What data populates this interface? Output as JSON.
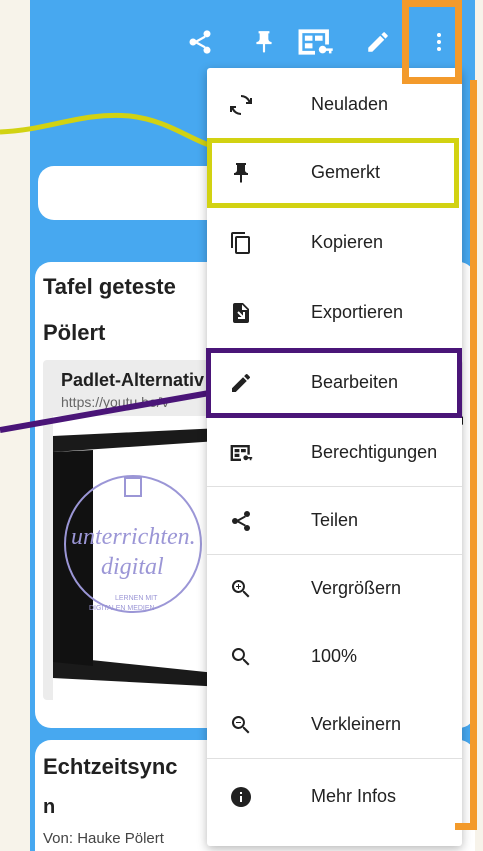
{
  "toolbar": {
    "icons": [
      "share-icon",
      "pin-icon",
      "permissions-icon",
      "edit-icon",
      "more-vert-icon"
    ]
  },
  "post1": {
    "title_line1": "Tafel geteste",
    "title_line2": "Pölert",
    "link_title": "Padlet-Alternativ",
    "link_url": "https://youtu.be/V",
    "thumb_text1": "unterrichten.",
    "thumb_text2": "digital",
    "thumb_text3": "LERNEN MIT",
    "thumb_text4": "DIGITALEN MEDIEN"
  },
  "post2": {
    "title_line1": "Echtzeitsync",
    "title_line2": "n",
    "author": "Von: Hauke Pölert"
  },
  "menu": {
    "items": [
      {
        "label": "Neuladen",
        "icon": "reload-icon"
      },
      {
        "label": "Gemerkt",
        "icon": "pin-icon"
      },
      {
        "label": "Kopieren",
        "icon": "copy-icon"
      },
      {
        "label": "Exportieren",
        "icon": "export-icon"
      },
      {
        "label": "Bearbeiten",
        "icon": "edit-icon"
      },
      {
        "label": "Berechtigungen",
        "icon": "permissions-icon"
      },
      {
        "label": "Teilen",
        "icon": "share-icon"
      },
      {
        "label": "Vergrößern",
        "icon": "zoom-in-icon"
      },
      {
        "label": "100%",
        "icon": "zoom-reset-icon"
      },
      {
        "label": "Verkleinern",
        "icon": "zoom-out-icon"
      },
      {
        "label": "Mehr Infos",
        "icon": "info-icon"
      }
    ]
  },
  "colors": {
    "background": "#47a8f0",
    "annotation_orange": "#f39a2b",
    "annotation_yellow": "#d2d212",
    "annotation_purple": "#4a1578"
  }
}
